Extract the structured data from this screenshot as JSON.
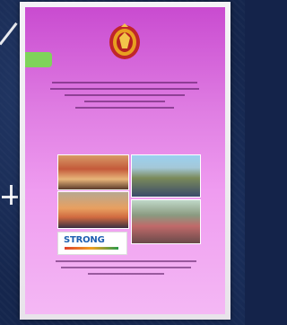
{
  "document": {
    "title_lines": [
      "",
      "",
      "",
      "",
      ""
    ],
    "logo_text": "STRONG",
    "footer_lines": [
      "",
      "",
      ""
    ]
  },
  "colors": {
    "background": "#15264d",
    "page_top": "#c94bd0",
    "page_bottom": "#f4b8f4",
    "tab": "#7fd35a",
    "text": "#4a1a5a",
    "logo": "#1d5fb0"
  },
  "icons": [
    "emblem-icon"
  ]
}
